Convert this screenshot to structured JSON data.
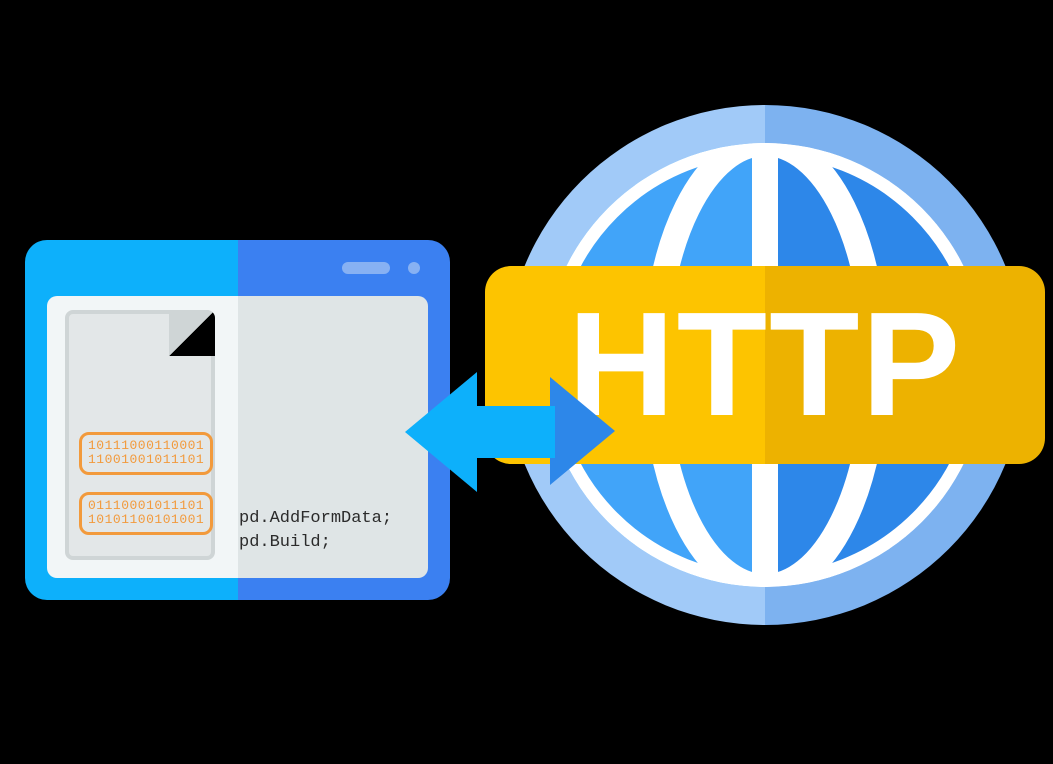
{
  "browser": {
    "file": {
      "binary1_line1": "10111000110001",
      "binary1_line2": "11001001011101",
      "binary2_line1": "01110001011101",
      "binary2_line2": "10101100101001"
    },
    "code_line1": "pd.AddFormData;",
    "code_line2": "pd.Build;"
  },
  "globe": {
    "label": "HTTP"
  }
}
